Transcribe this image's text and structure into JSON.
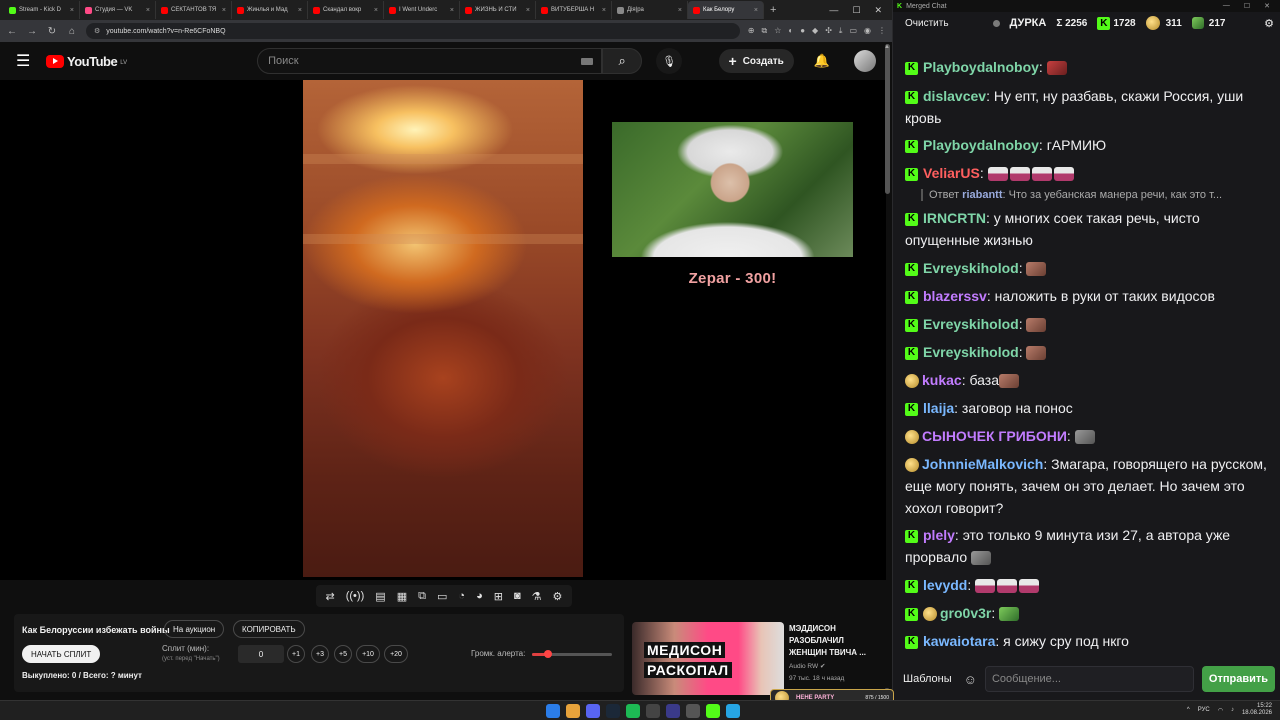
{
  "browser": {
    "tabs": [
      {
        "label": "Stream - Kick D",
        "fav": "#53fc18"
      },
      {
        "label": "Студия — VK",
        "fav": "#ff4a86"
      },
      {
        "label": "СЕКТАНТОВ ТЯ",
        "fav": "#ff0000"
      },
      {
        "label": "Жинлья и Мад",
        "fav": "#ff0000"
      },
      {
        "label": "Скандал вокр",
        "fav": "#ff0000"
      },
      {
        "label": "I Went Underc",
        "fav": "#ff0000"
      },
      {
        "label": "ЖИЗНЬ И СТИ",
        "fav": "#ff0000"
      },
      {
        "label": "ВИТУБЕРША Н",
        "fav": "#ff0000"
      },
      {
        "label": "Дія|ра",
        "fav": "#888888"
      },
      {
        "label": "Как Белору",
        "fav": "#ff0000"
      }
    ],
    "url": "youtube.com/watch?v=n-Re6CFoNBQ"
  },
  "youtube": {
    "logo_text": "YouTube",
    "country_code": "LV",
    "search_placeholder": "Поиск",
    "create_label": "Создать"
  },
  "video": {
    "overlay_caption": "Zepar - 300!"
  },
  "panel": {
    "title": "Как Белоруссии избежать войны",
    "auction_btn": "На аукцион",
    "copy_btn": "КОПИРОВАТЬ",
    "start_split_btn": "НАЧАТЬ СПЛИТ",
    "split_label": "Сплит (мин):",
    "split_hint": "(уст. перед \"Начать\")",
    "split_value": "0",
    "increments": [
      "+1",
      "+3",
      "+5",
      "+10",
      "+20"
    ],
    "alert_volume_label": "Громк. алерта:",
    "alert_volume_level": 0.2,
    "bought_text": "Выкуплено: 0 / Всего: ? минут"
  },
  "recommendation": {
    "thumb_line1": "МЕДИСОН",
    "thumb_line2": "РАСКОПАЛ",
    "title": "МЭДДИСОН РАЗОБЛАЧИЛ ЖЕНЩИН ТВИЧА ...",
    "channel": "Audio RW",
    "meta": "97 тыс.   18 ч назад"
  },
  "chat": {
    "window_title": "Merged Chat",
    "clear_btn": "Очистить",
    "channel": "ДУРКА",
    "total_label": "Σ 2256",
    "kick_count": "1728",
    "stat2": "311",
    "stat3": "217",
    "templates_btn": "Шаблоны",
    "input_placeholder": "Сообщение...",
    "send_btn": "Отправить",
    "messages": [
      {
        "user": "Playboydalnoboy",
        "color": "#7fd5a8",
        "text": ""
      },
      {
        "user": "dislavcev",
        "color": "#7fd5a8",
        "text": "Ну епт, ну разбавь, скажи Россия, уши кровь"
      },
      {
        "user": "Playboydalnoboy",
        "color": "#7fd5a8",
        "text": "гАРМИЮ"
      },
      {
        "user": "VeliarUS",
        "color": "#ff5f5f",
        "text": ""
      },
      {
        "user": "IRNCRTN",
        "color": "#7fd5a8",
        "text": "у многих соек такая речь, чисто опущенные жизнью"
      },
      {
        "user": "Evreyskiholod",
        "color": "#7fd5a8",
        "text": ""
      },
      {
        "user": "blazerssv",
        "color": "#c27cff",
        "text": "наложить в руки от таких видосов"
      },
      {
        "user": "Evreyskiholod",
        "color": "#7fd5a8",
        "text": ""
      },
      {
        "user": "Evreyskiholod",
        "color": "#7fd5a8",
        "text": ""
      },
      {
        "user": "kukac",
        "color": "#c27cff",
        "text": "база"
      },
      {
        "user": "llaija",
        "color": "#7ab8ff",
        "text": "заговор на понос"
      },
      {
        "user": "СЫНОЧЕК ГРИБОНИ",
        "color": "#c27cff",
        "text": ""
      },
      {
        "user": "JohnnieMalkovich",
        "color": "#7ab8ff",
        "text": "Змагара, говорящего на русском, еще могу понять, зачем он это делает. Но зачем это хохол говорит?"
      },
      {
        "user": "plely",
        "color": "#c27cff",
        "text": "это только 9 минута изи 27, а автора уже прорвало"
      },
      {
        "user": "levydd",
        "color": "#7ab8ff",
        "text": ""
      },
      {
        "user": "gro0v3r",
        "color": "#7fd5a8",
        "text": ""
      },
      {
        "user": "kawaiotara",
        "color": "#7ab8ff",
        "text": "я сижу сру под нкго"
      }
    ],
    "reply": {
      "prefix": "Ответ",
      "user": "riabantt",
      "text": "Что за уебанская манера речи, как это т..."
    }
  },
  "taskbar": {
    "lang": "РУС",
    "time": "15:22",
    "date": "18.08.2026",
    "kick_overlay_label": "HEHE PARTY",
    "kick_overlay_count": "875 / 1500"
  }
}
